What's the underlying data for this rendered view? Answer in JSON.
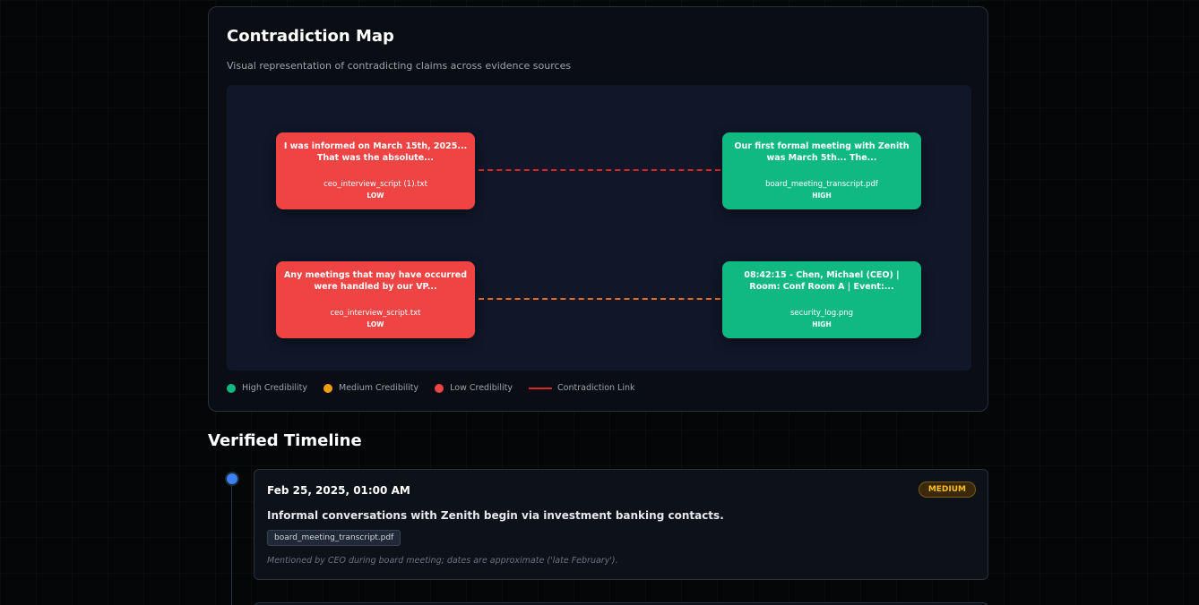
{
  "map": {
    "title": "Contradiction Map",
    "subtitle": "Visual representation of contradicting claims across evidence sources",
    "nodes": [
      {
        "text": "I was informed on March 15th, 2025... That was the absolute...",
        "file": "ceo_interview_script (1).txt",
        "credibility": "LOW"
      },
      {
        "text": "Our first formal meeting with Zenith was March 5th... The...",
        "file": "board_meeting_transcript.pdf",
        "credibility": "HIGH"
      },
      {
        "text": "Any meetings that may have occurred were handled by our VP...",
        "file": "ceo_interview_script.txt",
        "credibility": "LOW"
      },
      {
        "text": "08:42:15 - Chen, Michael (CEO) | Room: Conf Room A | Event:...",
        "file": "security_log.png",
        "credibility": "HIGH"
      }
    ],
    "legend": {
      "high": "High Credibility",
      "medium": "Medium Credibility",
      "low": "Low Credibility",
      "link": "Contradiction Link"
    },
    "colors": {
      "high": "#10b981",
      "medium": "#f59e0b",
      "low": "#ef4444",
      "link": "#dc2626"
    }
  },
  "timeline": {
    "title": "Verified Timeline",
    "events": [
      {
        "date": "Feb 25, 2025, 01:00 AM",
        "badge": "MEDIUM",
        "description": "Informal conversations with Zenith begin via investment banking contacts.",
        "source": "board_meeting_transcript.pdf",
        "note": "Mentioned by CEO during board meeting; dates are approximate ('late February')."
      }
    ]
  }
}
